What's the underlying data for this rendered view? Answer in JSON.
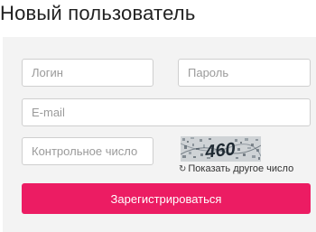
{
  "page": {
    "title": "Новый пользователь"
  },
  "form": {
    "login_placeholder": "Логин",
    "password_placeholder": "Пароль",
    "email_placeholder": "E-mail",
    "captcha_placeholder": "Контрольное число",
    "captcha_text": "460",
    "refresh_icon": "refresh-icon",
    "refresh_label": "Показать другое число",
    "submit_label": "Зарегистрироваться"
  },
  "colors": {
    "accent": "#ec1c63",
    "panel_bg": "#f3f3f3",
    "field_border": "#cfcfcf"
  }
}
